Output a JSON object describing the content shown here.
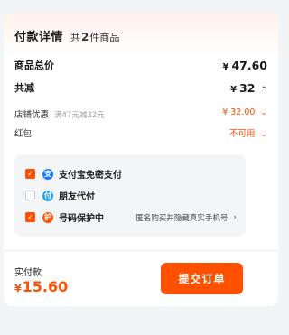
{
  "header": {
    "title": "付款详情",
    "count_prefix": "共",
    "count_value": "2",
    "count_suffix": "件商品"
  },
  "summary": {
    "goods_total": {
      "label": "商品总价",
      "currency": "¥",
      "value": "47.60"
    },
    "discount_total": {
      "label": "共减",
      "currency": "¥",
      "value": "32",
      "icon": "chevron-up-icon"
    },
    "store_discount": {
      "label": "店铺优惠",
      "note": "满47元减32元",
      "value": "¥ 32.00",
      "icon": "chevron-down-icon"
    },
    "red_packet": {
      "label": "红包",
      "value": "不可用",
      "icon": "chevron-down-icon"
    }
  },
  "options": [
    {
      "label": "支付宝免密支付",
      "checked": true,
      "icon": "alipay-icon",
      "icon_glyph": "支",
      "icon_color": "#1677ff"
    },
    {
      "label": "朋友代付",
      "checked": false,
      "icon": "friend-pay-icon",
      "icon_glyph": "付",
      "icon_color": "#2aa0e8"
    },
    {
      "label": "号码保护中",
      "checked": true,
      "icon": "number-protect-icon",
      "icon_glyph": "护",
      "icon_color": "#ff5000",
      "right_text": "匿名购买并隐藏真实手机号"
    }
  ],
  "footer": {
    "pay_label": "实付款",
    "currency": "¥",
    "amount": "15.60",
    "submit_label": "提交订单"
  },
  "colors": {
    "accent": "#ff5000",
    "panel": "#f4f5f7"
  }
}
